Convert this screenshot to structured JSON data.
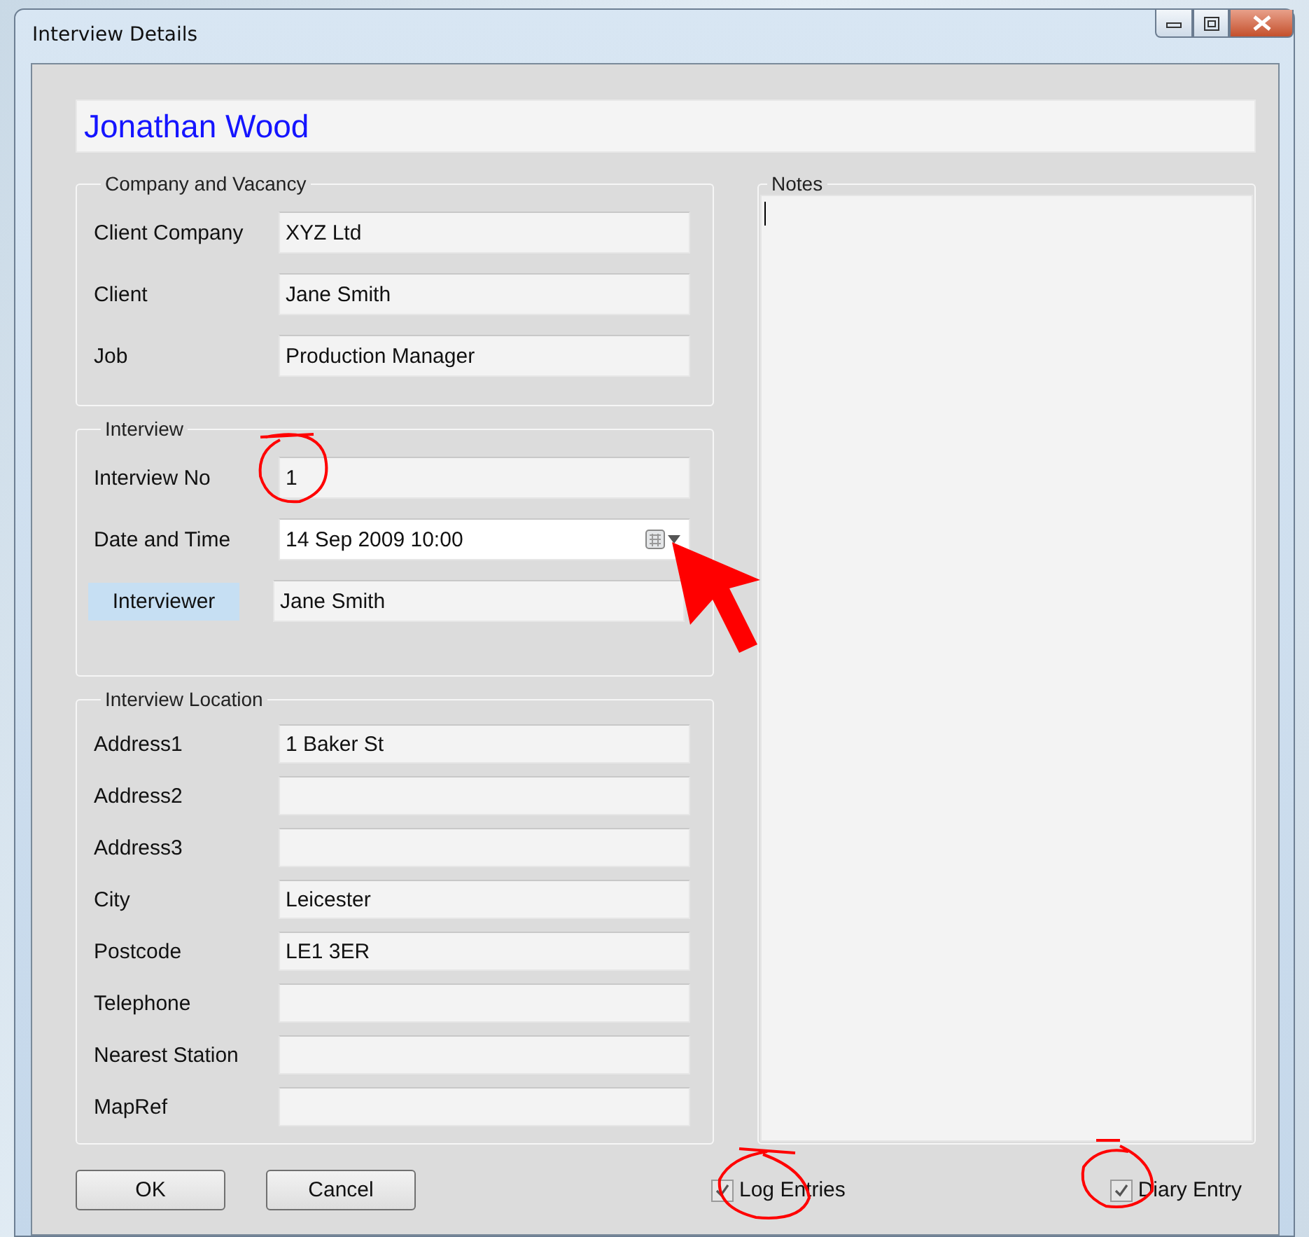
{
  "window": {
    "title": "Interview Details"
  },
  "name": "Jonathan Wood",
  "groups": [
    {
      "title": "Company and Vacancy",
      "rows": [
        {
          "label": "Client Company",
          "value": "XYZ Ltd",
          "kind": "text",
          "highlighted": false
        },
        {
          "label": "Client",
          "value": "Jane Smith",
          "kind": "text",
          "highlighted": false
        },
        {
          "label": "Job",
          "value": "Production Manager",
          "kind": "text",
          "highlighted": false
        }
      ]
    },
    {
      "title": "Interview",
      "rows": [
        {
          "label": "Interview No",
          "value": "1",
          "kind": "text",
          "highlighted": false
        },
        {
          "label": "Date and Time",
          "value": "14 Sep 2009 10:00",
          "kind": "date",
          "highlighted": false
        },
        {
          "label": "Interviewer",
          "value": "Jane Smith",
          "kind": "text",
          "highlighted": true
        }
      ]
    },
    {
      "title": "Interview Location",
      "rows": [
        {
          "label": "Address1",
          "value": "1 Baker St",
          "kind": "text",
          "highlighted": false
        },
        {
          "label": "Address2",
          "kind": "text",
          "highlighted": false
        },
        {
          "label": "Address3",
          "kind": "text",
          "highlighted": false
        },
        {
          "label": "City",
          "value": "Leicester",
          "kind": "text",
          "highlighted": false
        },
        {
          "label": "Postcode",
          "value": "LE1 3ER",
          "kind": "text",
          "highlighted": false
        },
        {
          "label": "Telephone",
          "kind": "text",
          "highlighted": false
        },
        {
          "label": "Nearest Station",
          "kind": "text",
          "highlighted": false
        },
        {
          "label": "MapRef",
          "kind": "text",
          "highlighted": false
        }
      ]
    }
  ],
  "notes": {
    "title": "Notes"
  },
  "buttons": [
    "OK",
    "Cancel"
  ],
  "checkboxes": [
    {
      "label": "Log Entries",
      "checked": true
    },
    {
      "label": "Diary Entry",
      "checked": true
    }
  ]
}
